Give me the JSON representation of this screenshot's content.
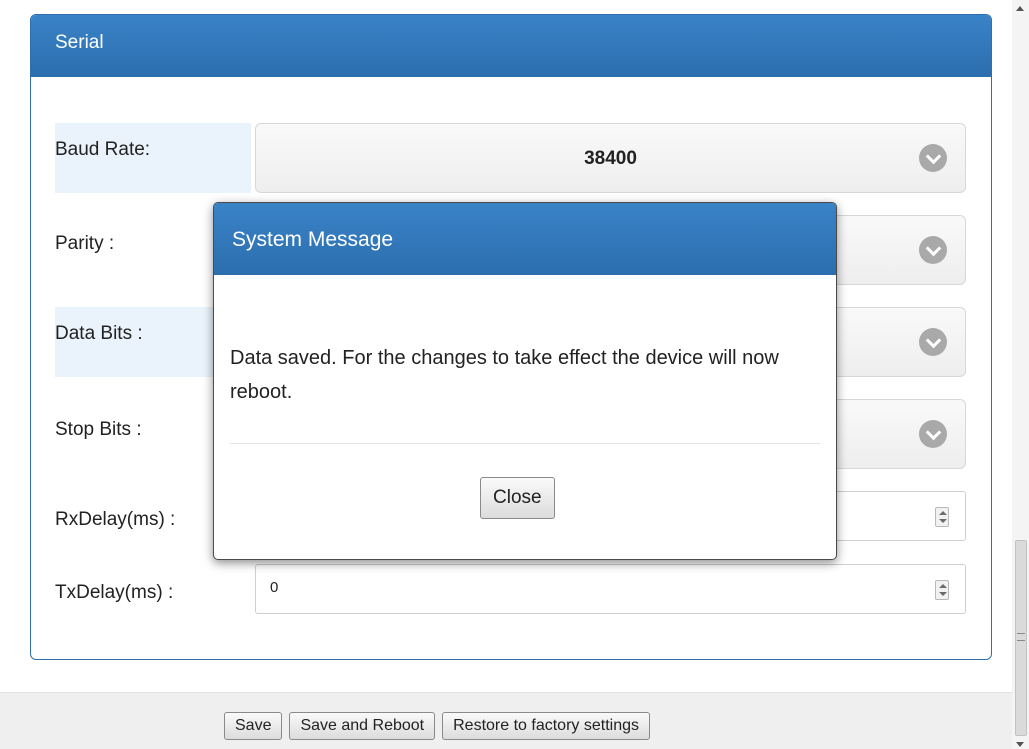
{
  "panel": {
    "title": "Serial"
  },
  "fields": {
    "baud_rate": {
      "label": "Baud Rate:",
      "value": "38400"
    },
    "parity": {
      "label": "Parity :"
    },
    "data_bits": {
      "label": "Data Bits :"
    },
    "stop_bits": {
      "label": "Stop Bits :"
    },
    "rx_delay": {
      "label": "RxDelay(ms) :"
    },
    "tx_delay": {
      "label": "TxDelay(ms) :",
      "value": "0"
    }
  },
  "footer": {
    "save_label": "Save",
    "save_reboot_label": "Save and Reboot",
    "restore_label": "Restore to factory settings"
  },
  "modal": {
    "title": "System Message",
    "message": "Data saved. For the changes to take effect the device will now reboot.",
    "close_label": "Close"
  },
  "colors": {
    "header_blue": "#2f74b5",
    "shaded_label_bg": "#eaf2fb"
  },
  "icons": {
    "select_chevron": "chevron-down-icon",
    "number_spinner": "spinner-icon"
  }
}
